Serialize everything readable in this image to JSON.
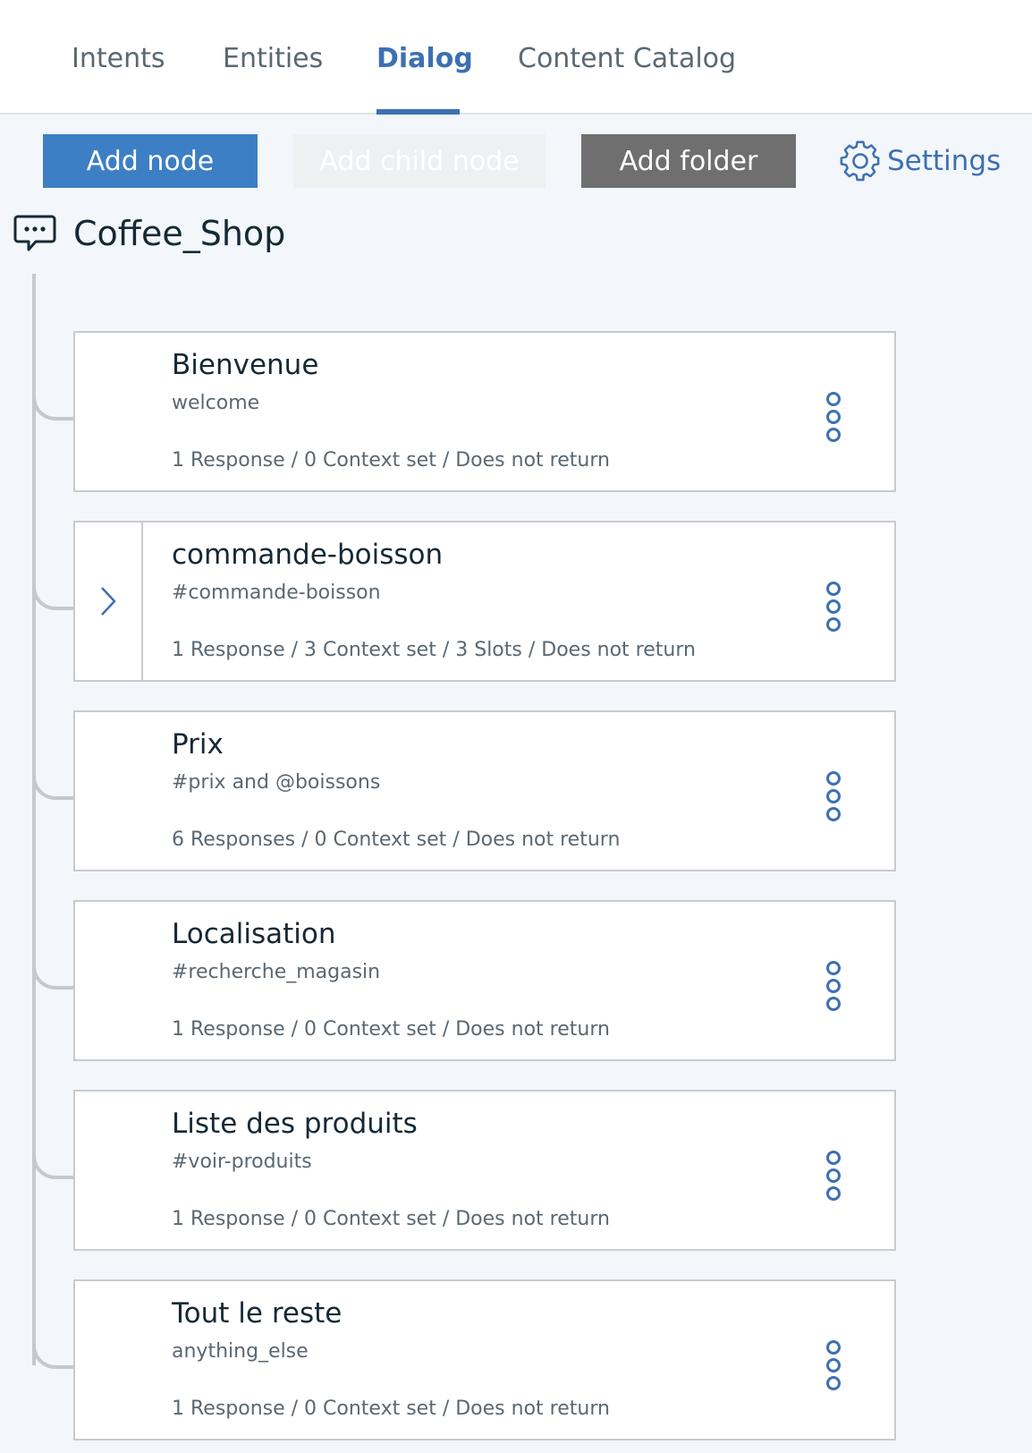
{
  "tabs": [
    {
      "label": "Intents",
      "active": false
    },
    {
      "label": "Entities",
      "active": false
    },
    {
      "label": "Dialog",
      "active": true
    },
    {
      "label": "Content Catalog",
      "active": false
    }
  ],
  "toolbar": {
    "add_node_label": "Add node",
    "add_child_node_label": "Add child node",
    "add_folder_label": "Add folder",
    "settings_label": "Settings",
    "settings_icon": "gear-icon"
  },
  "root": {
    "title": "Coffee_Shop",
    "icon": "chat-bubble-icon"
  },
  "nodes": [
    {
      "title": "Bienvenue",
      "condition": "welcome",
      "meta": "1 Response / 0 Context set / Does not return",
      "has_children": false
    },
    {
      "title": "commande-boisson",
      "condition": "#commande-boisson",
      "meta": "1 Response / 3 Context set / 3 Slots / Does not return",
      "has_children": true
    },
    {
      "title": "Prix",
      "condition": "#prix and @boissons",
      "meta": "6 Responses / 0 Context set / Does not return",
      "has_children": false
    },
    {
      "title": "Localisation",
      "condition": "#recherche_magasin",
      "meta": "1 Response / 0 Context set / Does not return",
      "has_children": false
    },
    {
      "title": "Liste des produits",
      "condition": "#voir-produits",
      "meta": "1 Response / 0 Context set / Does not return",
      "has_children": false
    },
    {
      "title": "Tout le reste",
      "condition": "anything_else",
      "meta": "1 Response / 0 Context set / Does not return",
      "has_children": false
    }
  ],
  "colors": {
    "accent": "#3d70b2",
    "primary_button": "#3d7fc4",
    "folder_button": "#6f6f6f",
    "background": "#f3f6fa"
  }
}
